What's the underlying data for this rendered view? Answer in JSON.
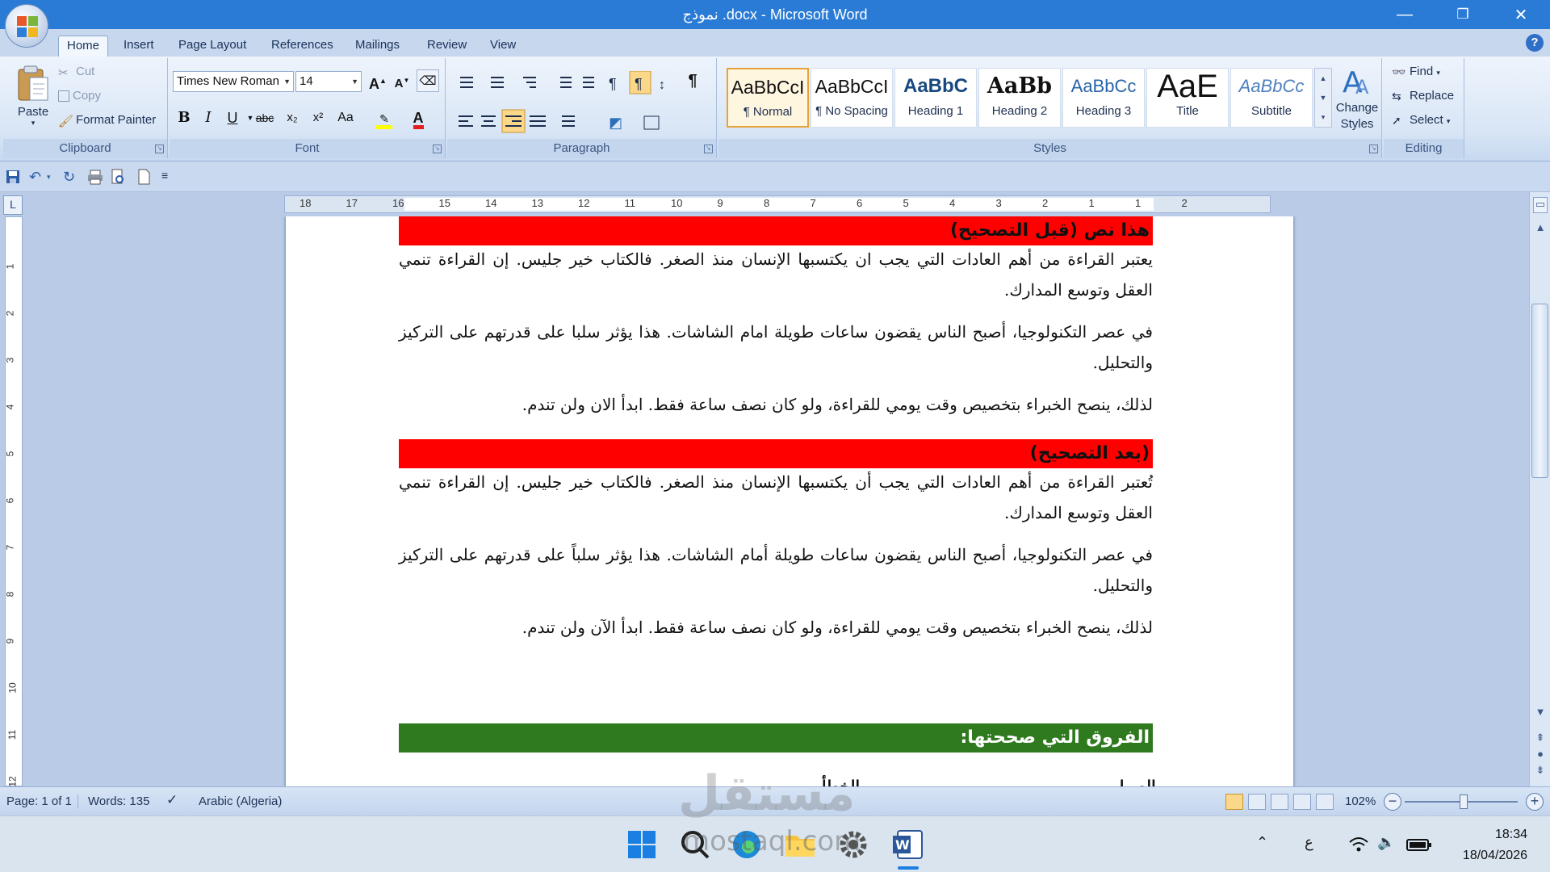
{
  "window": {
    "title": "نموذج .docx - Microsoft Word",
    "minimize": "—",
    "restore": "❐",
    "close": "✕"
  },
  "tabs": [
    "Home",
    "Insert",
    "Page Layout",
    "References",
    "Mailings",
    "Review",
    "View"
  ],
  "help_glyph": "?",
  "clipboard": {
    "paste": "Paste",
    "cut": "Cut",
    "copy": "Copy",
    "format_painter": "Format Painter",
    "label": "Clipboard"
  },
  "font": {
    "name": "Times New Roman",
    "size": "14",
    "label": "Font",
    "grow": "A",
    "shrink": "A",
    "bold": "B",
    "italic": "I",
    "underline": "U",
    "strike": "abc",
    "subscript": "x₂",
    "superscript": "x²",
    "case": "Aa",
    "color_glyph": "A"
  },
  "paragraph": {
    "label": "Paragraph",
    "show_marks": "¶"
  },
  "styles": {
    "label": "Styles",
    "items": [
      {
        "preview": "AaBbCcI",
        "name": "¶ Normal"
      },
      {
        "preview": "AaBbCcI",
        "name": "¶ No Spacing"
      },
      {
        "preview": "AaBbC",
        "name": "Heading 1"
      },
      {
        "preview": "AaBb",
        "name": "Heading 2"
      },
      {
        "preview": "AaBbCc",
        "name": "Heading 3"
      },
      {
        "preview": "AaE",
        "name": "Title"
      },
      {
        "preview": "AaBbCc",
        "name": "Subtitle"
      }
    ],
    "change_styles_line1": "Change",
    "change_styles_line2": "Styles"
  },
  "editing": {
    "label": "Editing",
    "find": "Find",
    "replace": "Replace",
    "select": "Select"
  },
  "ruler": {
    "corner": "L",
    "h_numbers": [
      "18",
      "17",
      "16",
      "15",
      "14",
      "13",
      "12",
      "11",
      "10",
      "9",
      "8",
      "7",
      "6",
      "5",
      "4",
      "3",
      "2",
      "1",
      "1",
      "2"
    ],
    "v_numbers": [
      "1",
      "2",
      "3",
      "4",
      "5",
      "6",
      "7",
      "8",
      "9",
      "10",
      "11",
      "12"
    ]
  },
  "document": {
    "before_header": "هذا نص (قبل التصحيح)",
    "before_paragraphs": [
      "يعتبر القراءة من أهم العادات التي يجب ان يكتسبها الإنسان منذ الصغر. فالكتاب خير جليس. إن القراءة تنمي العقل وتوسع المدارك.",
      "في عصر التكنولوجيا، أصبح الناس يقضون ساعات طويلة امام الشاشات. هذا يؤثر سلبا على قدرتهم على التركيز والتحليل.",
      "لذلك، ينصح الخبراء بتخصيص وقت يومي للقراءة، ولو كان نصف ساعة فقط. ابدأ الان ولن تندم."
    ],
    "after_header": "(بعد التصحيح)",
    "after_paragraphs": [
      "تُعتبر القراءة من أهم العادات التي يجب أن يكتسبها الإنسان منذ الصغر. فالكتاب خير جليس. إن القراءة تنمي العقل وتوسع المدارك.",
      "في عصر التكنولوجيا، أصبح الناس يقضون ساعات طويلة أمام الشاشات. هذا يؤثر سلباً على قدرتهم على التركيز والتحليل.",
      "لذلك، ينصح الخبراء بتخصيص وقت يومي للقراءة، ولو كان نصف ساعة فقط. ابدأ الآن ولن تندم."
    ],
    "diff_header": "الفروق التي صححتها:",
    "cut_col_right": "الصواب",
    "cut_col_left": "الخطأ"
  },
  "status": {
    "page": "Page: 1 of 1",
    "words": "Words: 135",
    "language": "Arabic (Algeria)",
    "zoom": "102%",
    "zoom_minus": "−",
    "zoom_plus": "+"
  },
  "taskbar": {
    "lang_indicator": "ع",
    "time": "18:34",
    "date": "18/04/2026"
  },
  "watermark": {
    "arabic": "مستقل",
    "latin": "mostaql.com"
  },
  "colors": {
    "red_band": "#ff0000",
    "green_band": "#2f7a1f",
    "title_bar": "#2a7bd6"
  }
}
